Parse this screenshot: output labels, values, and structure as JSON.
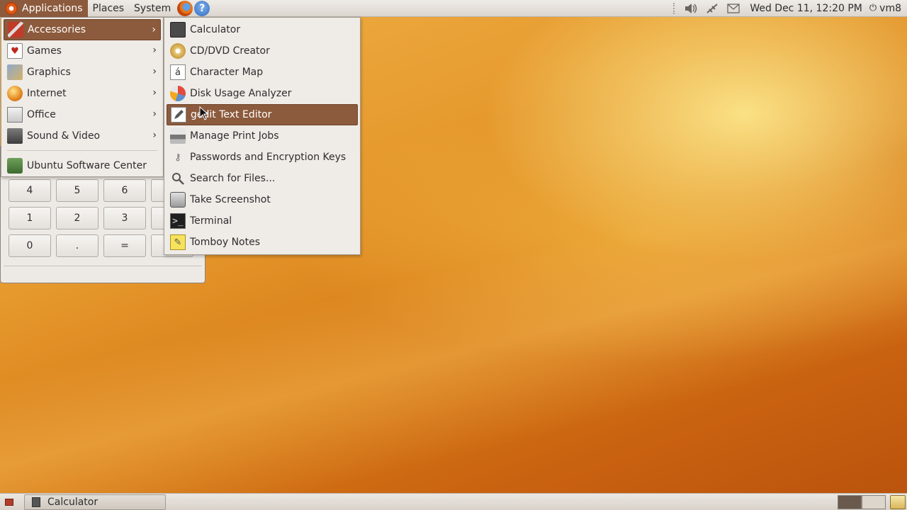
{
  "top_panel": {
    "menus": {
      "applications": "Applications",
      "places": "Places",
      "system": "System"
    },
    "launchers": {
      "help_glyph": "?"
    },
    "clock": "Wed Dec 11, 12:20 PM",
    "user": "vm8"
  },
  "applications_menu": {
    "items": [
      {
        "label": "Accessories",
        "icon": "accessories-icon",
        "submenu": true,
        "selected": true
      },
      {
        "label": "Games",
        "icon": "games-icon",
        "submenu": true
      },
      {
        "label": "Graphics",
        "icon": "graphics-icon",
        "submenu": true
      },
      {
        "label": "Internet",
        "icon": "internet-icon",
        "submenu": true
      },
      {
        "label": "Office",
        "icon": "office-icon",
        "submenu": true
      },
      {
        "label": "Sound & Video",
        "icon": "sound-video-icon",
        "submenu": true
      }
    ],
    "footer_item": {
      "label": "Ubuntu Software Center",
      "icon": "software-center-icon"
    }
  },
  "accessories_menu": {
    "items": [
      {
        "label": "Calculator",
        "icon": "calculator-icon"
      },
      {
        "label": "CD/DVD Creator",
        "icon": "cd-dvd-icon"
      },
      {
        "label": "Character Map",
        "icon": "character-map-icon",
        "glyph": "á"
      },
      {
        "label": "Disk Usage Analyzer",
        "icon": "disk-usage-icon"
      },
      {
        "label": "gedit Text Editor",
        "icon": "text-editor-icon",
        "selected": true
      },
      {
        "label": "Manage Print Jobs",
        "icon": "printer-icon"
      },
      {
        "label": "Passwords and Encryption Keys",
        "icon": "keys-icon"
      },
      {
        "label": "Search for Files...",
        "icon": "search-icon"
      },
      {
        "label": "Take Screenshot",
        "icon": "screenshot-icon"
      },
      {
        "label": "Terminal",
        "icon": "terminal-icon",
        "glyph": ">_"
      },
      {
        "label": "Tomboy Notes",
        "icon": "tomboy-icon"
      }
    ]
  },
  "calculator_window": {
    "buttons": [
      "4",
      "5",
      "6",
      "1",
      "2",
      "3",
      "0",
      ".",
      "="
    ]
  },
  "bottom_panel": {
    "taskbar": [
      {
        "label": "Calculator",
        "icon": "calculator-icon"
      }
    ]
  },
  "colors": {
    "menu_highlight": "#8c5a3c",
    "panel_bg": "#dcd6cf",
    "menu_bg": "#efebe7"
  }
}
